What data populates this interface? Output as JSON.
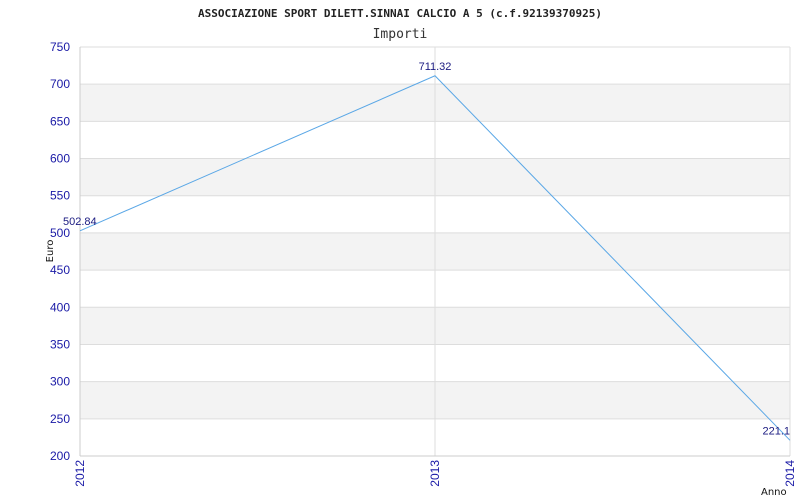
{
  "chart_data": {
    "type": "line",
    "title": "ASSOCIAZIONE SPORT DILETT.SINNAI CALCIO A 5 (c.f.92139370925)",
    "subtitle": "Importi",
    "xlabel": "Anno",
    "ylabel": "Euro",
    "x": [
      "2012",
      "2013",
      "2014"
    ],
    "series": [
      {
        "values": [
          502.84,
          711.32,
          221.1
        ]
      }
    ],
    "data_labels": [
      "502.84",
      "711.32",
      "221.1"
    ],
    "ylim": [
      200,
      750
    ],
    "yticks": [
      200,
      250,
      300,
      350,
      400,
      450,
      500,
      550,
      600,
      650,
      700,
      750
    ],
    "grid": true,
    "colors": {
      "line": "#5aa7e6",
      "band": "#f3f3f3",
      "grid": "#dddddd",
      "tick_text": "#1a1aa6"
    }
  }
}
